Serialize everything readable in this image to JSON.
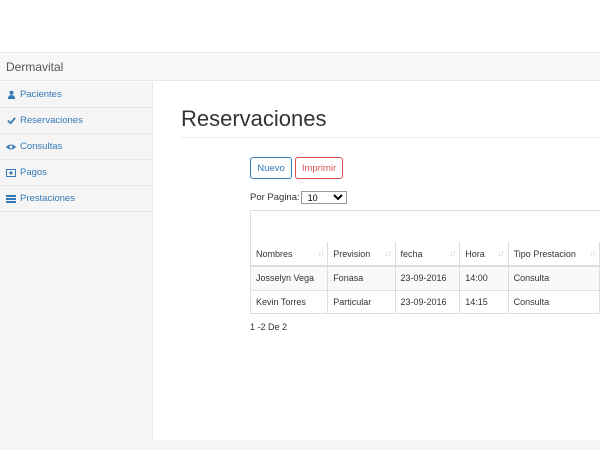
{
  "navbar": {
    "brand": "Dermavital"
  },
  "sidebar": {
    "items": [
      {
        "label": "Pacientes",
        "icon": "user-icon"
      },
      {
        "label": "Reservaciones",
        "icon": "check-icon"
      },
      {
        "label": "Consultas",
        "icon": "eye-icon"
      },
      {
        "label": "Pagos",
        "icon": "money-icon"
      },
      {
        "label": "Prestaciones",
        "icon": "list-icon"
      }
    ]
  },
  "main": {
    "title": "Reservaciones",
    "buttons": {
      "new": "Nuevo",
      "print": "Imprimir"
    },
    "per_page": {
      "label": "Por Pagina:",
      "value": "10"
    },
    "table": {
      "headers": [
        "Nombres",
        "Prevision",
        "fecha",
        "Hora",
        "Tipo Prestacion"
      ],
      "rows": [
        [
          "Josselyn Vega",
          "Fonasa",
          "23-09-2016",
          "14:00",
          "Consulta"
        ],
        [
          "Kevin Torres",
          "Particular",
          "23-09-2016",
          "14:15",
          "Consulta"
        ]
      ]
    },
    "pagination": "1 -2 De 2"
  },
  "colors": {
    "link": "#337ab7",
    "danger": "#d9534f"
  }
}
